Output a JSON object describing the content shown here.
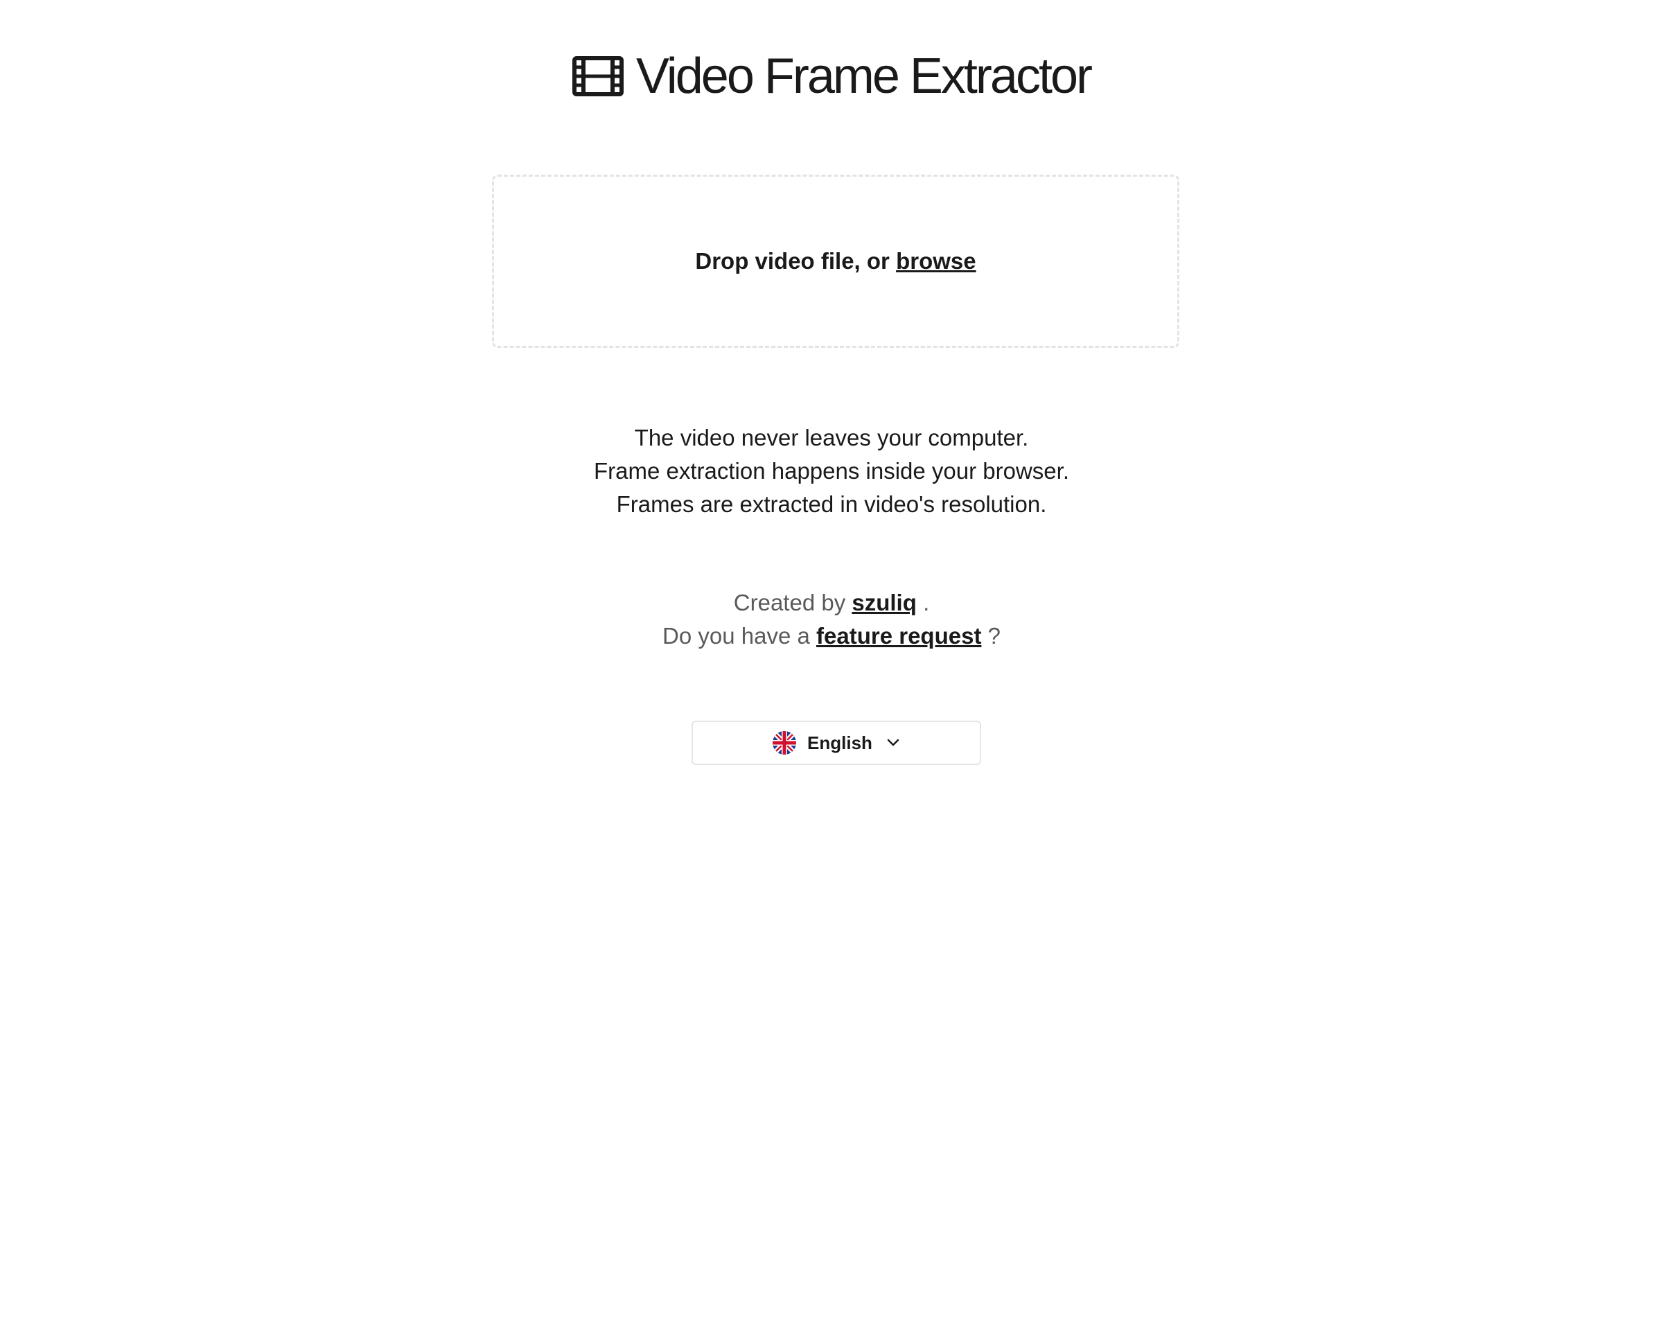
{
  "header": {
    "title": "Video Frame Extractor",
    "icon": "film-icon"
  },
  "dropzone": {
    "prompt": "Drop video file, or",
    "browse_label": "browse"
  },
  "info": {
    "lines": [
      "The video never leaves your computer.",
      "Frame extraction happens inside your browser.",
      "Frames are extracted in video's resolution."
    ]
  },
  "credits": {
    "created_prefix": "Created by",
    "author": "szuliq",
    "created_suffix": ".",
    "feature_prefix": "Do you have a",
    "feature_link": "feature request",
    "feature_suffix": "?"
  },
  "language": {
    "selected": "English",
    "flag_icon": "uk-flag-icon",
    "chevron_icon": "chevron-down-icon"
  },
  "colors": {
    "text": "#1a1a1a",
    "muted": "#5a5a5a",
    "border": "#e3e3e3"
  }
}
